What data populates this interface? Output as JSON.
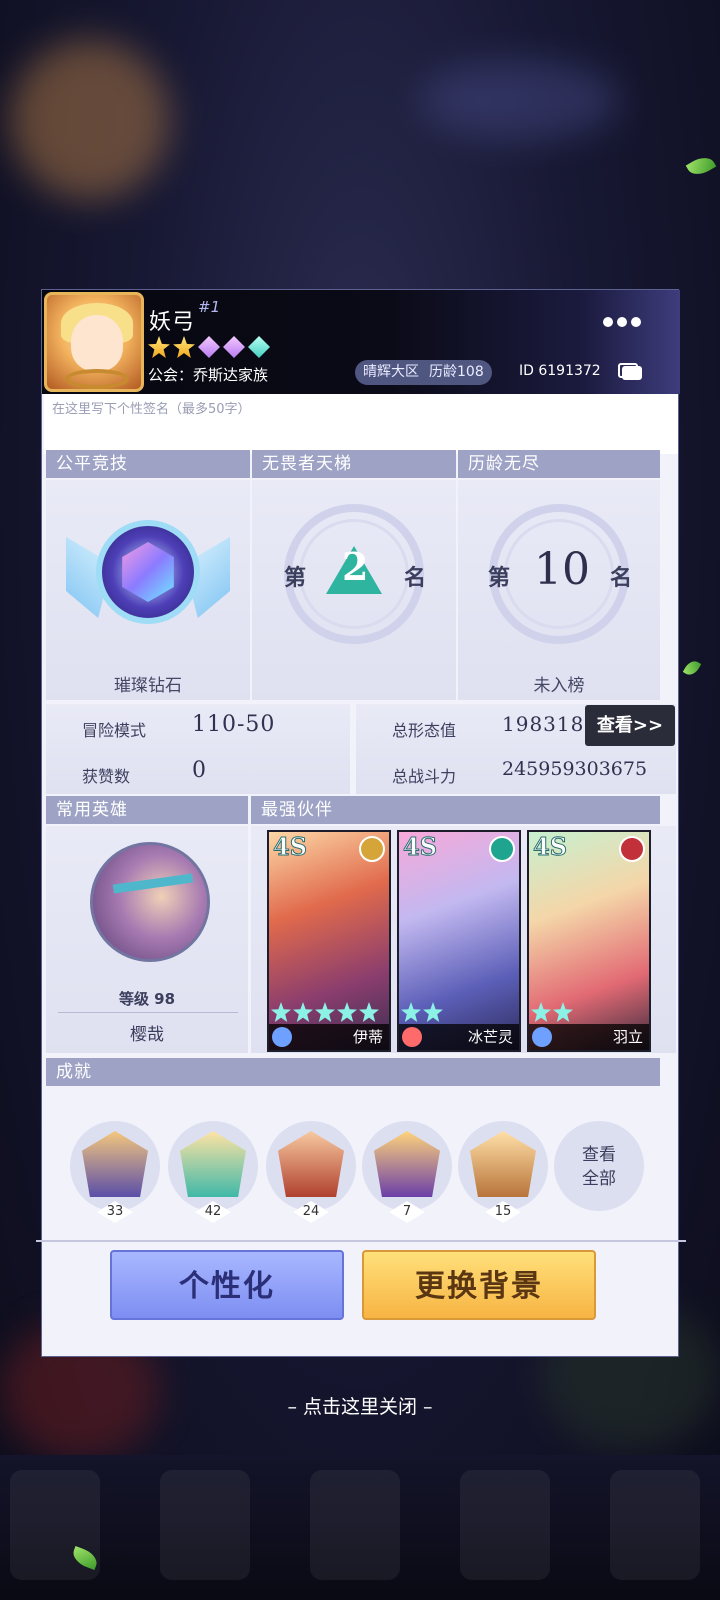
{
  "player": {
    "name": "妖弓",
    "rank_tag": "#1",
    "guild": "公会：乔斯达家族",
    "server": "晴辉大区",
    "age": "历龄108",
    "id": "ID 6191372",
    "signature_placeholder": "在这里写下个性签名（最多50字）"
  },
  "sections": {
    "fair": "公平竞技",
    "ladder": "无畏者天梯",
    "endless": "历龄无尽",
    "common_hero": "常用英雄",
    "best_partner": "最强伙伴",
    "achievements": "成就"
  },
  "ranks": {
    "fair_label": "璀璨钻石",
    "ladder_prefix": "第",
    "ladder_num": "2",
    "ladder_suffix": "名",
    "endless_prefix": "第",
    "endless_num": "10",
    "endless_suffix": "名",
    "endless_label": "未入榜"
  },
  "stats": {
    "adventure_label": "冒险模式",
    "adventure_value": "110-50",
    "likes_label": "获赞数",
    "likes_value": "0",
    "form_label": "总形态值",
    "form_value": "198318",
    "view_btn": "查看>>",
    "power_label": "总战斗力",
    "power_value": "245959303675"
  },
  "hero": {
    "level": "等级 98",
    "name": "樱哉"
  },
  "partners": [
    {
      "grade": "4S",
      "name": "伊蒂",
      "stars": 5
    },
    {
      "grade": "4S",
      "name": "冰芒灵",
      "stars": 2
    },
    {
      "grade": "4S",
      "name": "羽立",
      "stars": 2
    }
  ],
  "achievements": {
    "counts": [
      "33",
      "42",
      "24",
      "7",
      "15"
    ],
    "view_all": "查看全部"
  },
  "buttons": {
    "personalize": "个性化",
    "change_bg": "更换背景"
  },
  "close_hint": "– 点击这里关闭 –",
  "colors": {
    "section_header": "#9ea3c6",
    "panel_bg": "#f1f2fa",
    "personalize_btn": "#8e9df6",
    "bg_btn": "#fbc757"
  }
}
